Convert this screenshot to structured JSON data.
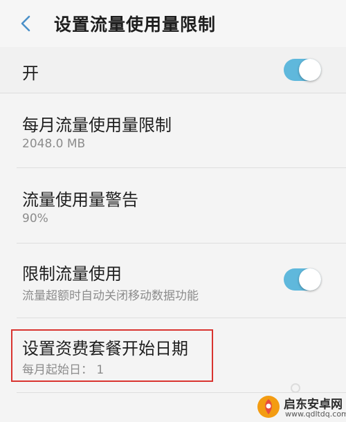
{
  "header": {
    "title": "设置流量使用量限制",
    "back_icon": "chevron-left-icon"
  },
  "master_switch": {
    "label": "开",
    "enabled": true
  },
  "settings": [
    {
      "title": "每月流量使用量限制",
      "subtitle": "2048.0 MB"
    },
    {
      "title": "流量使用量警告",
      "subtitle": "90%"
    },
    {
      "title": "限制流量使用",
      "subtitle": "流量超额时自动关闭移动数据功能",
      "toggle_on": true
    },
    {
      "title": "设置资费套餐开始日期",
      "subtitle": "每月起始日： 1"
    }
  ],
  "watermark": {
    "name": "启东安卓网",
    "url": "www.qdltdq.com"
  },
  "colors": {
    "toggle_on": "#5fb8dc",
    "back_icon": "#4a90c8",
    "highlight": "#d9332f"
  }
}
